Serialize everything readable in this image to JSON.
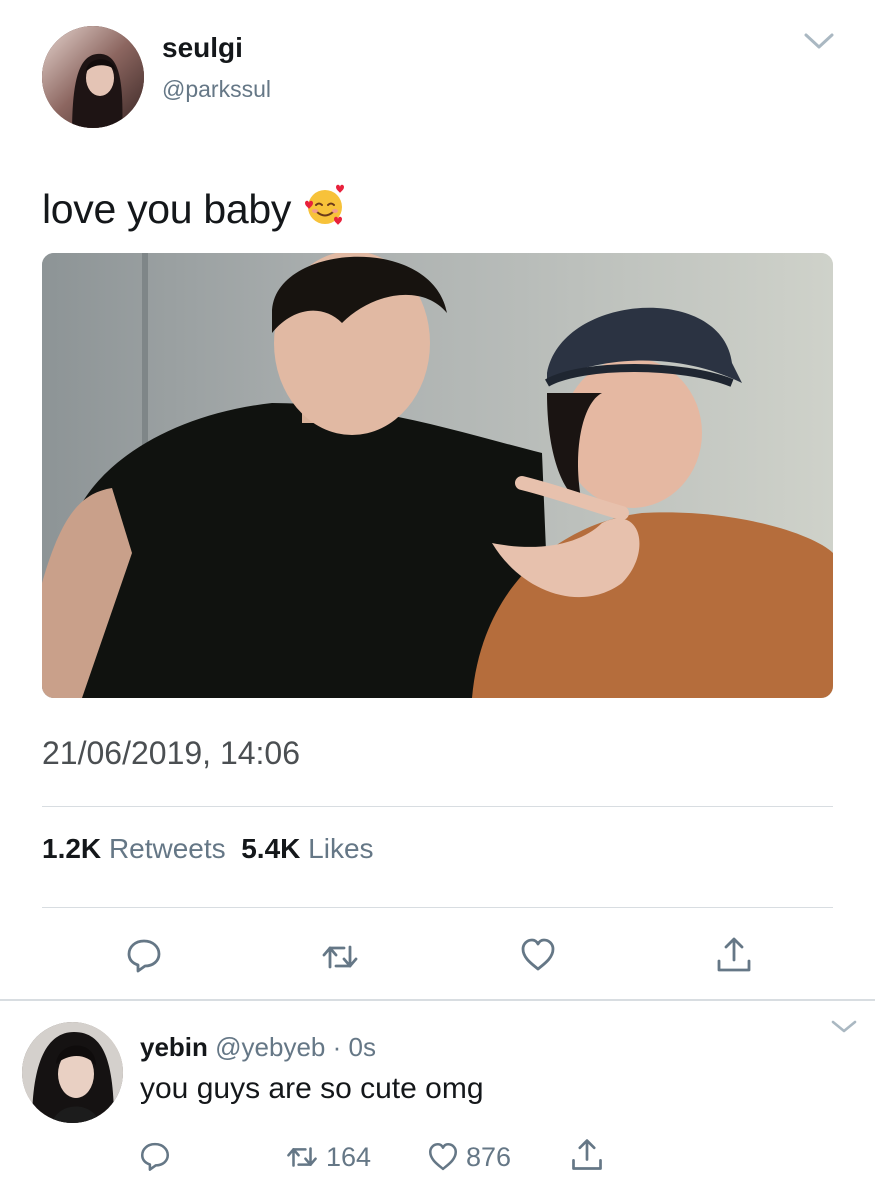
{
  "tweet": {
    "author": {
      "name": "seulgi",
      "handle": "@parkssul"
    },
    "text": "love you baby",
    "emoji": "smiling-face-with-hearts-icon",
    "timestamp": "21/06/2019, 14:06",
    "stats": {
      "retweets_count": "1.2K",
      "retweets_label": "Retweets",
      "likes_count": "5.4K",
      "likes_label": "Likes"
    }
  },
  "reply": {
    "name": "yebin",
    "handle": "@yebyeb",
    "separator": "·",
    "time": "0s",
    "text": "you guys are so cute omg",
    "retweets": "164",
    "likes": "876"
  },
  "colors": {
    "text_primary": "#14171a",
    "text_secondary": "#657786",
    "divider": "#d8dde1"
  }
}
